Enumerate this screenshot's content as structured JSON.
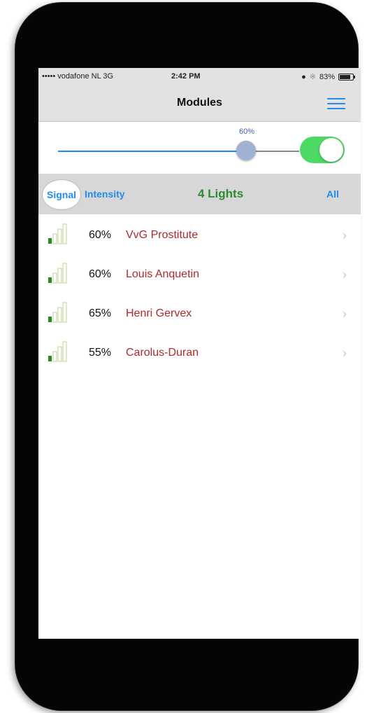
{
  "status_bar": {
    "carrier": "••••• vodafone NL  3G",
    "time": "2:42 PM",
    "battery": "83%"
  },
  "nav": {
    "title": "Modules",
    "menu_icon": "hamburger-menu-icon"
  },
  "slider": {
    "value_label": "60%",
    "value": 0.6,
    "toggle_on": true
  },
  "segment": {
    "signal": "Signal",
    "intensity": "Intensity",
    "lights": "4 Lights",
    "all": "All"
  },
  "colors": {
    "accent": "#1e8cf0",
    "toggle": "#4cd964",
    "name": "#b22a2a",
    "lights": "#2e8b2e"
  },
  "modules": [
    {
      "percent": "60%",
      "name": "VvG Prostitute",
      "signal_bars": 1
    },
    {
      "percent": "60%",
      "name": "Louis Anquetin",
      "signal_bars": 1
    },
    {
      "percent": "65%",
      "name": "Henri Gervex",
      "signal_bars": 1
    },
    {
      "percent": "55%",
      "name": "Carolus-Duran",
      "signal_bars": 1
    }
  ]
}
